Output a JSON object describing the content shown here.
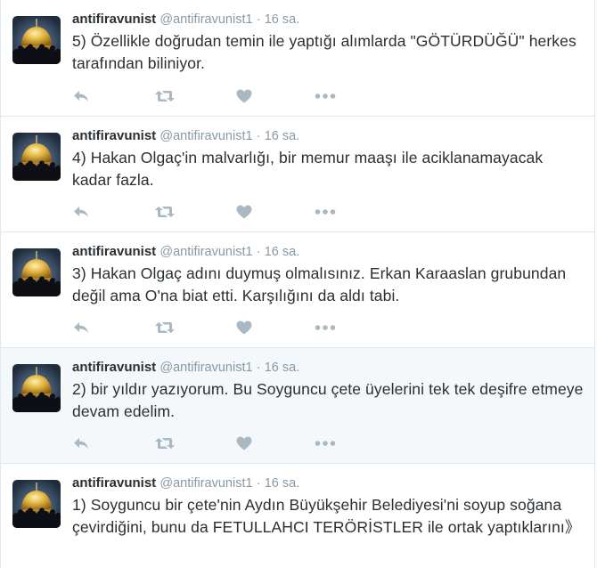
{
  "colors": {
    "icon": "#aab8c2",
    "meta": "#8899a6",
    "text": "#292f33",
    "border": "#e1e8ed",
    "highlight": "#f5f8fa"
  },
  "icons": [
    "reply-icon",
    "retweet-icon",
    "like-heart-icon",
    "more-dots-icon"
  ],
  "tweets": [
    {
      "fullname": "antifiravunist",
      "username": "@antifiravunist1",
      "separator": "·",
      "time": "16 sa.",
      "text": "5) Özellikle doğrudan temin ile yaptığı alımlarda \"GÖTÜRDÜĞÜ\" herkes tarafından biliniyor."
    },
    {
      "fullname": "antifiravunist",
      "username": "@antifiravunist1",
      "separator": "·",
      "time": "16 sa.",
      "text": "4) Hakan Olgaç'in malvarlığı, bir memur maaşı ile aciklanamayacak kadar fazla."
    },
    {
      "fullname": "antifiravunist",
      "username": "@antifiravunist1",
      "separator": "·",
      "time": "16 sa.",
      "text": "3) Hakan Olgaç adını duymuş olmalısınız. Erkan Karaaslan grubundan değil ama O'na biat etti. Karşılığını da aldı tabi."
    },
    {
      "fullname": "antifiravunist",
      "username": "@antifiravunist1",
      "separator": "·",
      "time": "16 sa.",
      "text": "2) bir yıldır yazıyorum. Bu Soyguncu çete üyelerini tek tek deşifre etmeye devam edelim."
    },
    {
      "fullname": "antifiravunist",
      "username": "@antifiravunist1",
      "separator": "·",
      "time": "16 sa.",
      "text": "1) Soyguncu bir çete'nin Aydın Büyükşehir Belediyesi'ni soyup soğana çevirdiğini, bunu da FETULLAHCI TERÖRİSTLER ile ortak yaptıklarını》"
    }
  ]
}
